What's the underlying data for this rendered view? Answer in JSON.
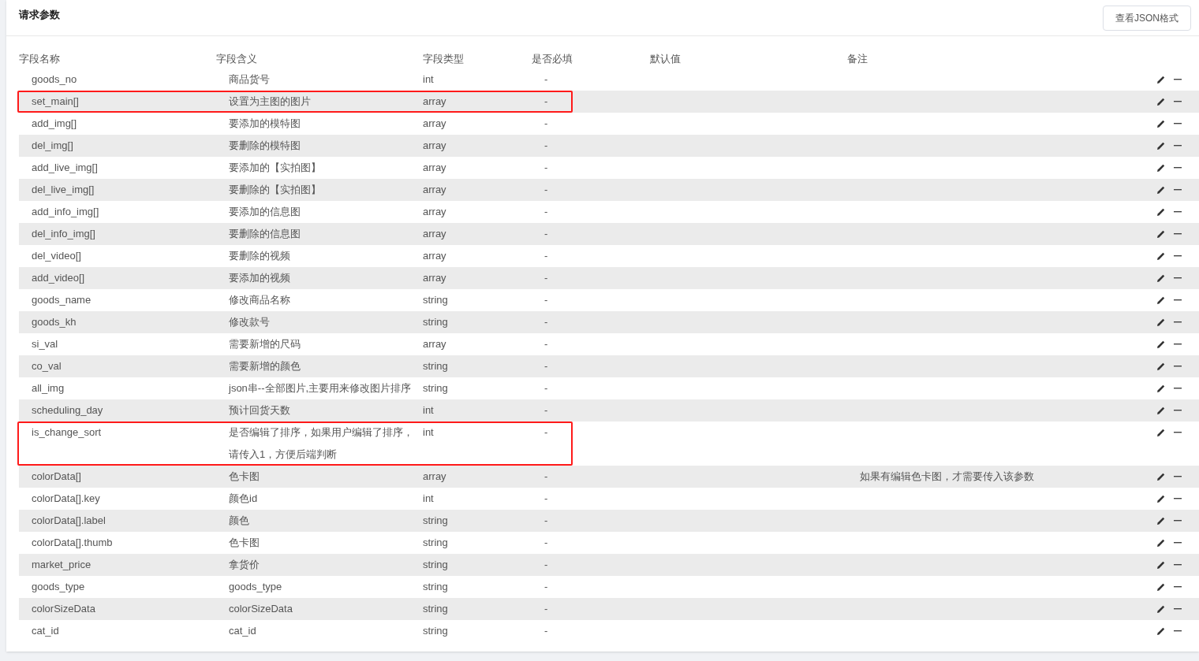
{
  "panel": {
    "title": "请求参数",
    "json_button": "查看JSON格式"
  },
  "table": {
    "columns": [
      "字段名称",
      "字段含义",
      "字段类型",
      "是否必填",
      "默认值",
      "备注"
    ],
    "rows": [
      {
        "name": "goods_no",
        "meaning": "商品货号",
        "type": "int",
        "required": "-",
        "highlighted": false
      },
      {
        "name": "set_main[]",
        "meaning": "设置为主图的图片",
        "type": "array",
        "required": "-",
        "highlighted": true
      },
      {
        "name": "add_img[]",
        "meaning": "要添加的模特图",
        "type": "array",
        "required": "-",
        "highlighted": false
      },
      {
        "name": "del_img[]",
        "meaning": "要删除的模特图",
        "type": "array",
        "required": "-",
        "highlighted": false
      },
      {
        "name": "add_live_img[]",
        "meaning": "要添加的【实拍图】",
        "type": "array",
        "required": "-",
        "highlighted": false
      },
      {
        "name": "del_live_img[]",
        "meaning": "要删除的【实拍图】",
        "type": "array",
        "required": "-",
        "highlighted": false
      },
      {
        "name": "add_info_img[]",
        "meaning": "要添加的信息图",
        "type": "array",
        "required": "-",
        "highlighted": false
      },
      {
        "name": "del_info_img[]",
        "meaning": "要删除的信息图",
        "type": "array",
        "required": "-",
        "highlighted": false
      },
      {
        "name": "del_video[]",
        "meaning": "要删除的视频",
        "type": "array",
        "required": "-",
        "highlighted": false
      },
      {
        "name": "add_video[]",
        "meaning": "要添加的视频",
        "type": "array",
        "required": "-",
        "highlighted": false
      },
      {
        "name": "goods_name",
        "meaning": "修改商品名称",
        "type": "string",
        "required": "-",
        "highlighted": false
      },
      {
        "name": "goods_kh",
        "meaning": "修改款号",
        "type": "string",
        "required": "-",
        "highlighted": false
      },
      {
        "name": "si_val",
        "meaning": "需要新增的尺码",
        "type": "array",
        "required": "-",
        "highlighted": false
      },
      {
        "name": "co_val",
        "meaning": "需要新增的颜色",
        "type": "string",
        "required": "-",
        "highlighted": false
      },
      {
        "name": "all_img",
        "meaning": "json串--全部图片,主要用来修改图片排序",
        "type": "string",
        "required": "-",
        "highlighted": false
      },
      {
        "name": "scheduling_day",
        "meaning": "预计回货天数",
        "type": "int",
        "required": "-",
        "highlighted": false
      },
      {
        "name": "is_change_sort",
        "meaning": "是否编辑了排序，如果用户编辑了排序，请传入1，方便后端判断",
        "type": "int",
        "required": "-",
        "highlighted": true
      },
      {
        "name": "colorData[]",
        "meaning": "色卡图",
        "type": "array",
        "required": "-",
        "remark": "如果有编辑色卡图，才需要传入该参数",
        "highlighted": false
      },
      {
        "name": "colorData[].key",
        "meaning": "颜色id",
        "type": "int",
        "required": "-",
        "highlighted": false
      },
      {
        "name": "colorData[].label",
        "meaning": "颜色",
        "type": "string",
        "required": "-",
        "highlighted": false
      },
      {
        "name": "colorData[].thumb",
        "meaning": "色卡图",
        "type": "string",
        "required": "-",
        "highlighted": false
      },
      {
        "name": "market_price",
        "meaning": "拿货价",
        "type": "string",
        "required": "-",
        "highlighted": false
      },
      {
        "name": "goods_type",
        "meaning": "goods_type",
        "type": "string",
        "required": "-",
        "highlighted": false
      },
      {
        "name": "colorSizeData",
        "meaning": "colorSizeData",
        "type": "string",
        "required": "-",
        "highlighted": false
      },
      {
        "name": "cat_id",
        "meaning": "cat_id",
        "type": "string",
        "required": "-",
        "highlighted": false
      }
    ]
  }
}
